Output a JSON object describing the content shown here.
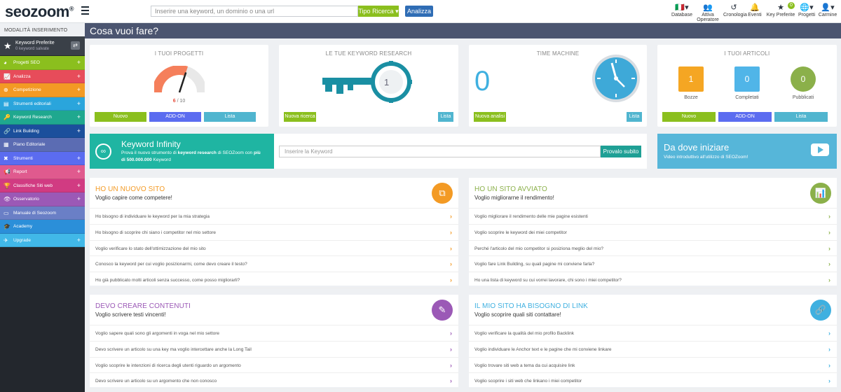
{
  "topbar": {
    "logo_a": "seo",
    "logo_b": "zoom",
    "logo_reg": "®",
    "search_placeholder": "Inserire una keyword, un dominio o una url",
    "search_type": "Tipo Ricerca ▾",
    "analyze": "Analizza",
    "nav": [
      {
        "icon": "🇮🇹▾",
        "label": "Database"
      },
      {
        "icon": "👥",
        "label": "Attiva Operatore"
      },
      {
        "icon": "↺",
        "label": "Cronologia"
      },
      {
        "icon": "🔔",
        "label": "Eventi"
      },
      {
        "icon": "★",
        "label": "Key Preferite",
        "badge": "0"
      },
      {
        "icon": "🌐▾",
        "label": "Progetti"
      },
      {
        "icon": "👤▾",
        "label": "Carmine"
      }
    ]
  },
  "sidebar": {
    "heading": "MODALITÀ INSERIMENTO",
    "fav_title": "Keyword Preferite",
    "fav_sub": "0 keyword salvate",
    "items": [
      {
        "label": "Progetti SEO",
        "icon": "◕",
        "color": "#8bbf1e",
        "plus": "+"
      },
      {
        "label": "Analizza",
        "icon": "📈",
        "color": "#e74c5a",
        "plus": "+"
      },
      {
        "label": "Competizione",
        "icon": "⊕",
        "color": "#f39a24",
        "plus": "+"
      },
      {
        "label": "Strumenti editoriali",
        "icon": "▤",
        "color": "#2aa5dc",
        "plus": "+"
      },
      {
        "label": "Keyword Research",
        "icon": "🔑",
        "color": "#1fa88f",
        "plus": "+"
      },
      {
        "label": "Link Building",
        "icon": "🔗",
        "color": "#1b4f9c",
        "plus": "+"
      },
      {
        "label": "Piano Editoriale",
        "icon": "▦",
        "color": "#5b6cb3",
        "plus": ""
      },
      {
        "label": "Strumenti",
        "icon": "✖",
        "color": "#5b6cf0",
        "plus": "+"
      },
      {
        "label": "Report",
        "icon": "📢",
        "color": "#e05a8e",
        "plus": "+"
      },
      {
        "label": "Classifiche Siti web",
        "icon": "🏆",
        "color": "#d13b82",
        "plus": "+"
      },
      {
        "label": "Osservatorio",
        "icon": "👁",
        "color": "#9b59b6",
        "plus": "+"
      },
      {
        "label": "Manuale di Seozoom",
        "icon": "▭",
        "color": "#6a7fc6",
        "plus": ""
      },
      {
        "label": "Academy",
        "icon": "🎓",
        "color": "#2b8fd9",
        "plus": ""
      },
      {
        "label": "Upgrade",
        "icon": "✈",
        "color": "#41b8e8",
        "plus": "+"
      }
    ]
  },
  "main": {
    "title": "Cosa vuoi fare?",
    "cards": {
      "progetti": {
        "title": "I TUOI PROGETTI",
        "count": "6",
        "total": "/ 10",
        "gauge_fraction": 0.6,
        "buttons": [
          "Nuovo",
          "ADD-ON",
          "Lista"
        ]
      },
      "keyword": {
        "title": "LE TUE KEYWORD RESEARCH",
        "value": "1",
        "buttons": [
          "Nuova ricerca",
          "Lista"
        ]
      },
      "time": {
        "title": "TIME MACHINE",
        "value": "0",
        "buttons": [
          "Nuova analisi",
          "Lista"
        ]
      },
      "articoli": {
        "title": "I TUOI ARTICOLI",
        "stats": [
          {
            "value": "1",
            "label": "Bozze",
            "color": "#f5a623"
          },
          {
            "value": "0",
            "label": "Completati",
            "color": "#50b5e8"
          },
          {
            "value": "0",
            "label": "Pubblicati",
            "color": "#8bb04a"
          }
        ],
        "buttons": [
          "Nuovo",
          "ADD-ON",
          "Lista"
        ]
      }
    },
    "infinity": {
      "title": "Keyword Infinity",
      "desc_a": "Prova il nuovo strumento di ",
      "desc_b": "keyword research",
      "desc_c": " di SEOZoom con ",
      "desc_d": "più di 500.000.000",
      "desc_e": " Keyword",
      "placeholder": "Inserire la Keyword",
      "button": "Provalo subito"
    },
    "dove": {
      "title": "Da dove iniziare",
      "sub": "Video introduttivo all'utilizzo di SEOZoom!"
    },
    "panels": [
      {
        "h1": "HO UN NUOVO SITO",
        "h2": "Voglio capire come competere!",
        "color": "#f39a24",
        "icon": "⧉",
        "rows": [
          "Ho bisogno di individuare le keyword per la mia strategia",
          "Ho bisogno di scoprire chi siano i competitor nel mio settore",
          "Voglio verificare lo stato dell'ottimizzazione del mio sito",
          "Conosco la keyword per cui voglio posizionarmi, come devo creare il testo?",
          "Ho già  pubblicato molti articoli senza successo, come posso migliorarli?"
        ]
      },
      {
        "h1": "HO UN SITO AVVIATO",
        "h2": "Voglio migliorarne il rendimento!",
        "color": "#8bb04a",
        "icon": "📊",
        "rows": [
          "Voglio migliorare il rendimento delle mie pagine esistenti",
          "Voglio scoprire le keyword dei miei competitor",
          "Perché l'articolo del mio competitor si posiziona meglio del mio?",
          "Voglio fare Link Building, su quali pagine mi conviene farla?",
          "Ho una lista di keyword su cui vorrei lavorare, chi sono i miei competitor?"
        ]
      },
      {
        "h1": "DEVO CREARE CONTENUTI",
        "h2": "Voglio scrivere testi vincenti!",
        "color": "#9b59b6",
        "icon": "✎",
        "rows": [
          "Voglio sapere quali sono gli argomenti in voga nel mio settore",
          "Devo scrivere un articolo su una key ma voglio intercettare anche la Long Tail",
          "Voglio scoprire le intenzioni di ricerca degli utenti riguardo un argomento",
          "Devo scrivere un articolo su un argomento che non conosco"
        ]
      },
      {
        "h1": "IL MIO SITO HA BISOGNO DI LINK",
        "h2": "Voglio scoprire quali siti contattare!",
        "color": "#3fb0e0",
        "icon": "🔗",
        "rows": [
          "Voglio verificare la qualità  del mio profilo Backlink",
          "Voglio individuare le Anchor text e le pagine che mi conviene linkare",
          "Voglio trovare siti web a tema da cui acquisire link",
          "Voglio scoprire i siti web che linkano i miei competitor"
        ]
      }
    ],
    "chevron": "›"
  }
}
